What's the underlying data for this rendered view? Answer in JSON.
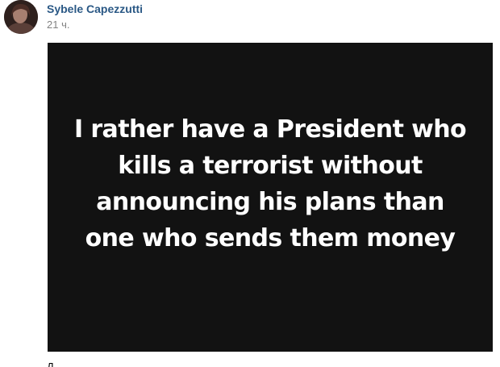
{
  "post": {
    "author_name": "Sybele Capezzutti",
    "timestamp": "21 ч.",
    "image_text": "I rather have a President who kills a terrorist without announcing his plans than one who sends them money",
    "text_preview": "Д"
  },
  "colors": {
    "author_link": "#2a5885",
    "timestamp": "#828282",
    "image_background": "#121212",
    "image_text": "#ffffff"
  },
  "icons": {
    "avatar": "profile-photo"
  }
}
